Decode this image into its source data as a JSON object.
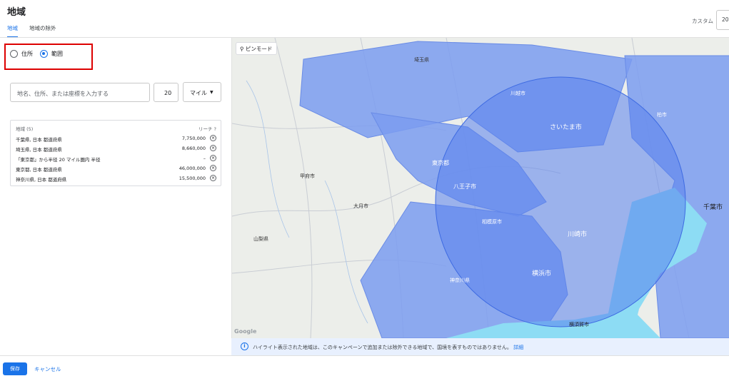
{
  "header": {
    "title": "地域",
    "date_label": "カスタム",
    "date_value": "20"
  },
  "tabs": [
    {
      "label": "地域",
      "active": true
    },
    {
      "label": "地域の除外",
      "active": false
    }
  ],
  "targeting": {
    "options": [
      {
        "label": "住所",
        "selected": false
      },
      {
        "label": "範囲",
        "selected": true
      }
    ],
    "search_placeholder": "地名、住所、または座標を入力する",
    "radius": "20",
    "unit": "マイル"
  },
  "locations": {
    "header": "地域 (5)",
    "reach_label": "リーチ",
    "help_icon": "?",
    "remove_icon": "⊗",
    "rows": [
      {
        "name": "千葉県, 日本 都道府県",
        "reach": "7,750,000"
      },
      {
        "name": "埼玉県, 日本 都道府県",
        "reach": "8,660,000"
      },
      {
        "name": "「東京都」から半径 20 マイル圏内 半径",
        "reach": "–"
      },
      {
        "name": "東京都, 日本 都道府県",
        "reach": "46,000,000"
      },
      {
        "name": "神奈川県, 日本 都道府県",
        "reach": "15,500,000"
      }
    ]
  },
  "map": {
    "pin_mode_label": "ピンモード",
    "attribution": "Google",
    "labels": [
      {
        "text": "埼玉県"
      },
      {
        "text": "東京都"
      },
      {
        "text": "山梨県"
      },
      {
        "text": "神奈川県"
      },
      {
        "text": "さいたま市"
      },
      {
        "text": "川崎市"
      },
      {
        "text": "横浜市"
      },
      {
        "text": "千葉市"
      },
      {
        "text": "八王子市"
      },
      {
        "text": "相模原市"
      },
      {
        "text": "横須賀市"
      },
      {
        "text": "川越市"
      },
      {
        "text": "柏市"
      },
      {
        "text": "甲府市"
      },
      {
        "text": "大月市"
      }
    ],
    "colors": {
      "region": "#7b9cf0",
      "radius": "#5a82ec",
      "sea": "#8ddcf4",
      "land": "#eceeea"
    }
  },
  "info_bar": {
    "icon": "i",
    "text": "ハイライト表示された地域は、このキャンペーンで追加または除外できる地域で、国境を表すものではありません。",
    "link": "詳細"
  },
  "footer": {
    "save": "保存",
    "cancel": "キャンセル"
  }
}
